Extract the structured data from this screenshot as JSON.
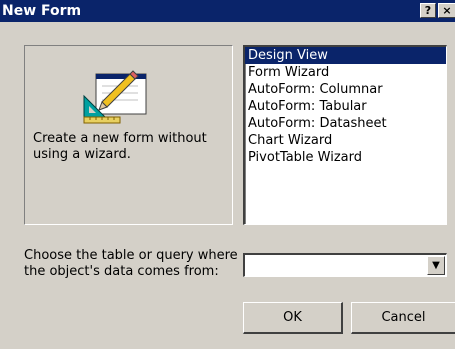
{
  "window": {
    "title": "New Form",
    "help_label": "?",
    "close_label": "×"
  },
  "preview": {
    "icon": "form-design-icon",
    "description": "Create a new form without using a wizard."
  },
  "form_types": {
    "selected": "Design View",
    "items": [
      "Design View",
      "Form Wizard",
      "AutoForm: Columnar",
      "AutoForm: Tabular",
      "AutoForm: Datasheet",
      "Chart Wizard",
      "PivotTable Wizard"
    ]
  },
  "source": {
    "label": "Choose the table or query where the object's data comes from:",
    "value": "",
    "arrow_icon": "dropdown-arrow-icon"
  },
  "buttons": {
    "ok": "OK",
    "cancel": "Cancel"
  },
  "colors": {
    "titlebar": "#0a246a",
    "face": "#d4d0c8",
    "selection": "#0a246a"
  }
}
